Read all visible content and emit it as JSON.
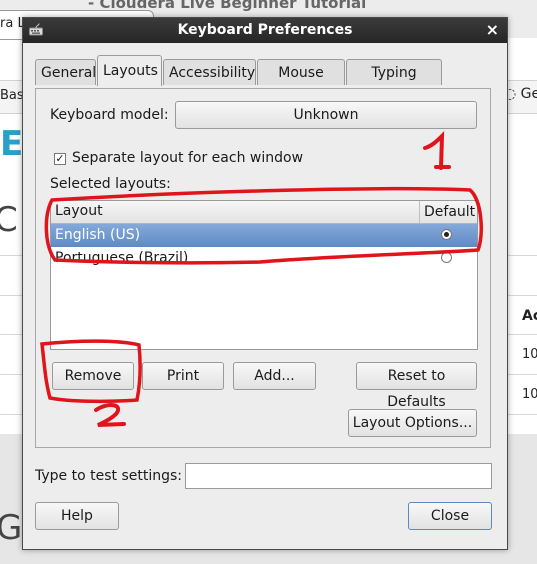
{
  "background": {
    "title_fragment": "- Cloudera Live Beginner Tutorial",
    "tab_fragment": "ra L",
    "left_fragment": "Bas",
    "right_fragment": "Get",
    "big_e": "E",
    "big_c": "C",
    "col_header": "Ac",
    "cell_1": "10",
    "cell_2": "10",
    "big_ge": "Ge"
  },
  "dialog": {
    "title": "Keyboard Preferences",
    "close_glyph": "×",
    "tabs": [
      {
        "label": "General"
      },
      {
        "label": "Layouts"
      },
      {
        "label": "Accessibility"
      },
      {
        "label": "Mouse Keys"
      },
      {
        "label": "Typing Break"
      }
    ],
    "active_tab": "Layouts",
    "keyboard_model_label": "Keyboard model:",
    "keyboard_model_value": "Unknown",
    "separate_layout_label": "Separate layout for each window",
    "separate_layout_checked": true,
    "selected_layouts_label": "Selected layouts:",
    "list": {
      "col_layout": "Layout",
      "col_default": "Default",
      "rows": [
        {
          "name": "English (US)",
          "default": true,
          "selected": true
        },
        {
          "name": "Portuguese (Brazil)",
          "default": false,
          "selected": false
        }
      ]
    },
    "buttons": {
      "remove": "Remove",
      "print": "Print",
      "add": "Add...",
      "reset": "Reset to Defaults",
      "layout_options": "Layout Options...",
      "help": "Help",
      "close": "Close"
    },
    "test_label": "Type to test settings:",
    "test_value": ""
  },
  "annotations": {
    "number_1": "1",
    "number_2": "2",
    "color": "#e0141b"
  },
  "colors": {
    "selection": "#6f97cf",
    "titlebar": "#2f2f2f"
  }
}
